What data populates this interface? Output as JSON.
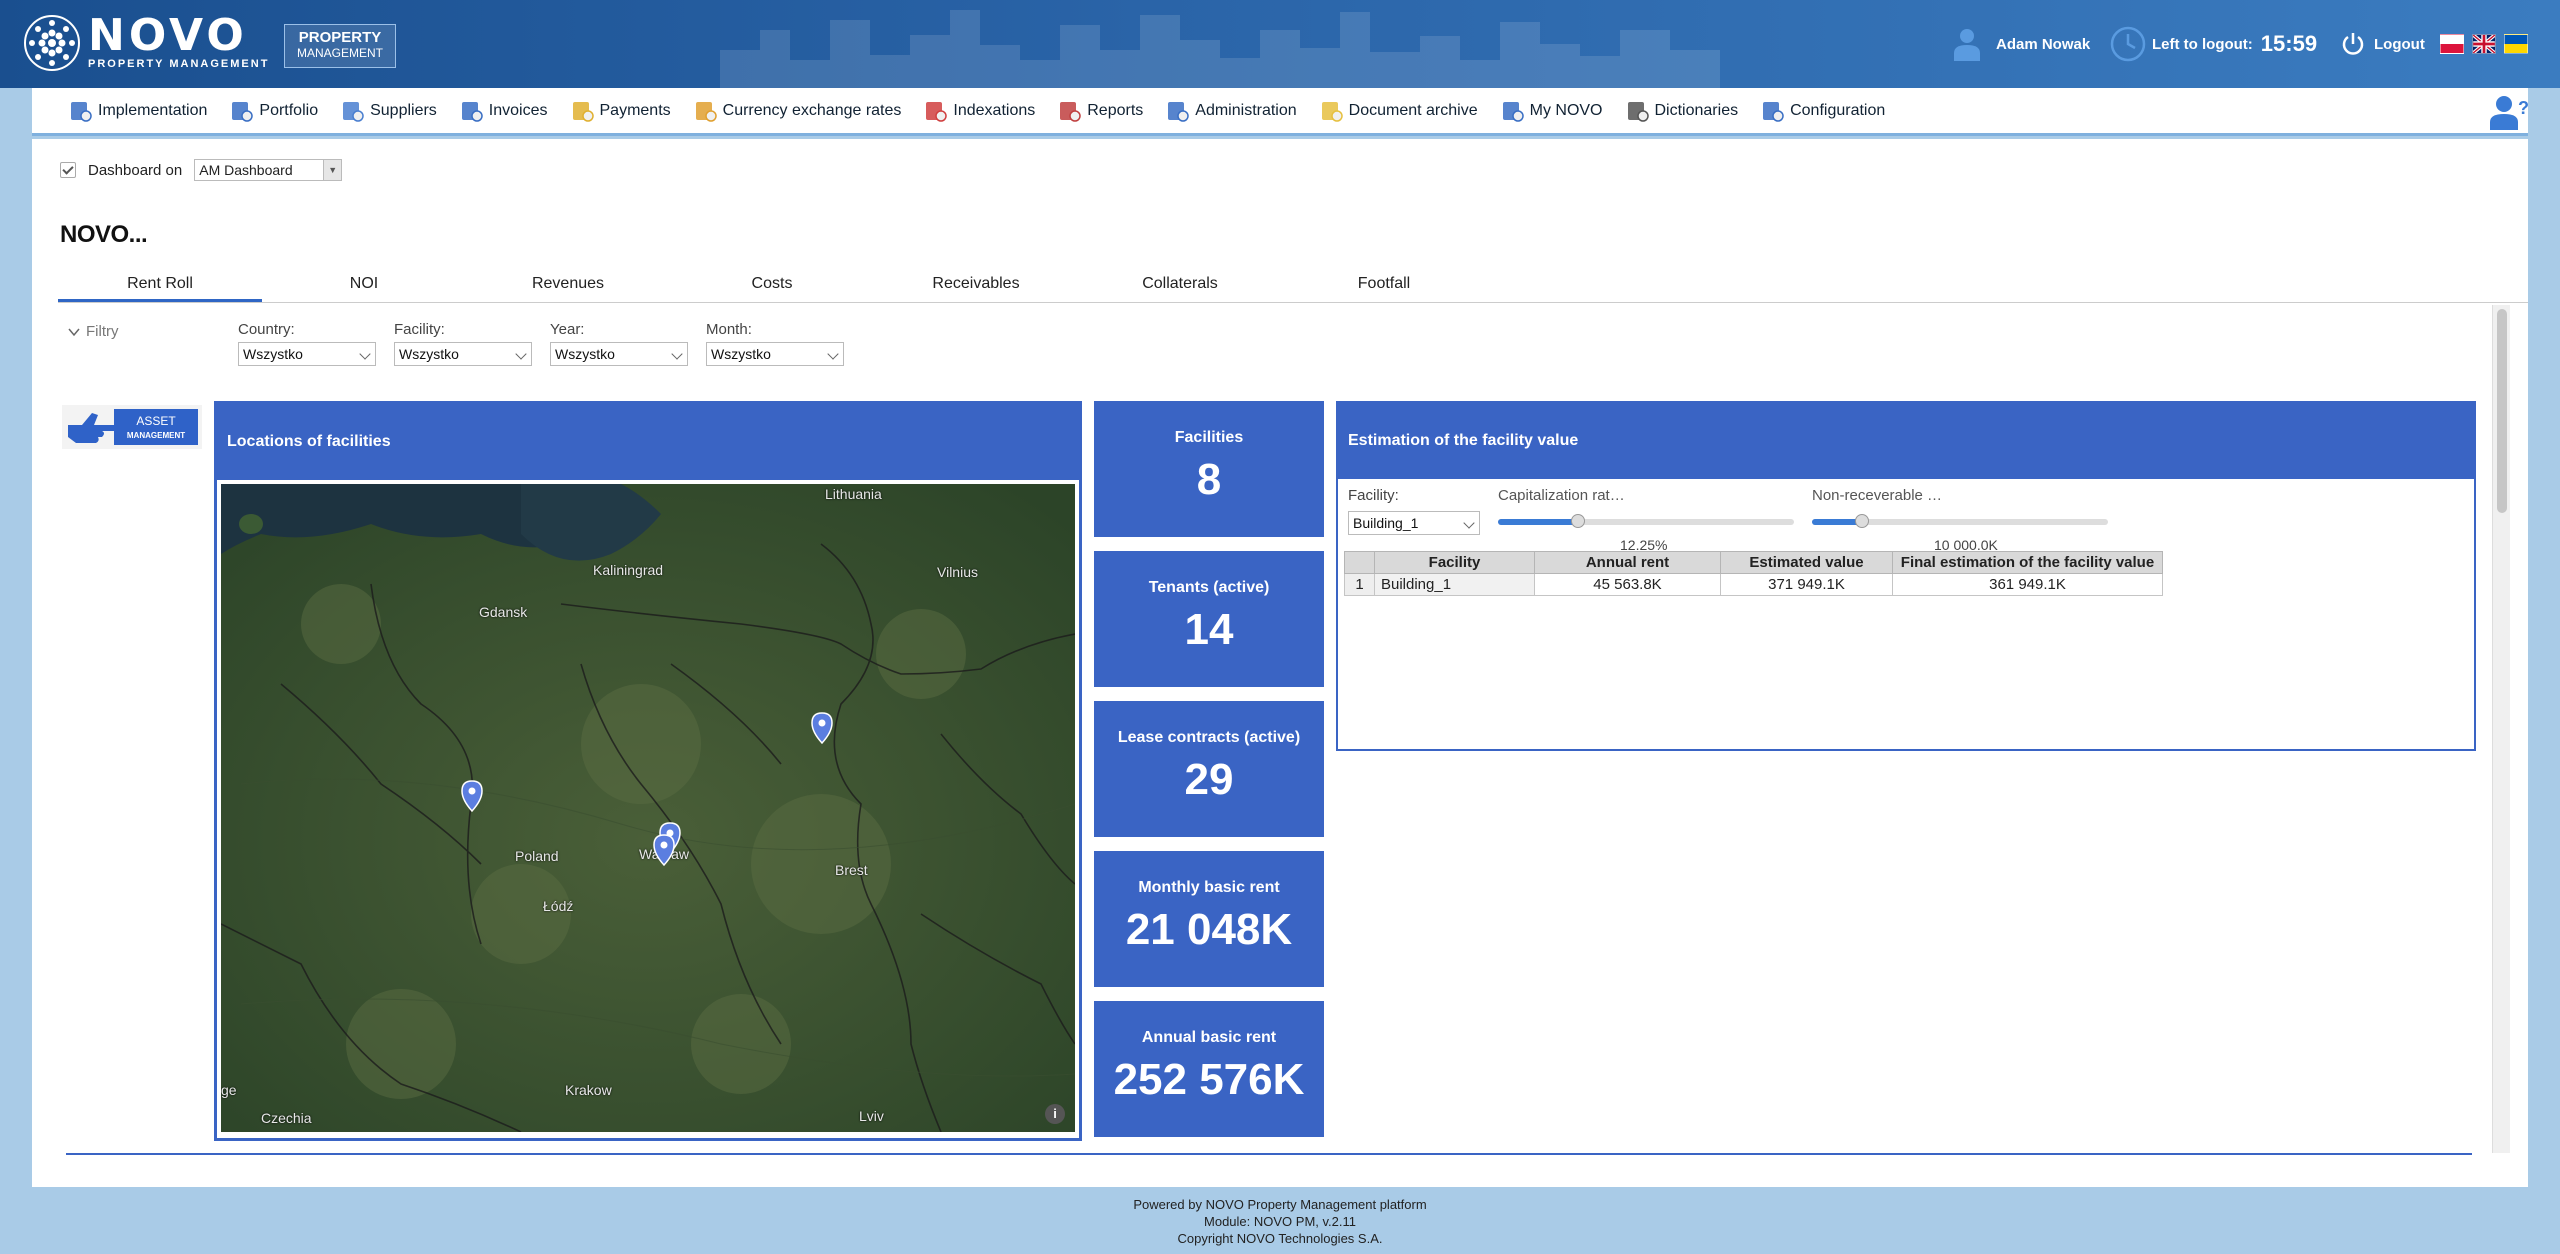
{
  "header": {
    "logo_text": "NOVO",
    "logo_sub": "PROPERTY MANAGEMENT",
    "product_box": [
      "PROPERTY",
      "MANAGEMENT"
    ],
    "user_name": "Adam Nowak",
    "logout_label_prefix": "Left to logout:",
    "logout_timer": "15:59",
    "logout_button": "Logout",
    "flags": [
      "pl-flag",
      "uk-flag",
      "ua-flag"
    ]
  },
  "nav": {
    "items": [
      {
        "label": "Implementation",
        "icon": "document-gear-icon"
      },
      {
        "label": "Portfolio",
        "icon": "buildings-icon"
      },
      {
        "label": "Suppliers",
        "icon": "supplier-cart-icon"
      },
      {
        "label": "Invoices",
        "icon": "invoice-icon"
      },
      {
        "label": "Payments",
        "icon": "money-icon"
      },
      {
        "label": "Currency exchange rates",
        "icon": "currency-icon"
      },
      {
        "label": "Indexations",
        "icon": "chart-up-icon"
      },
      {
        "label": "Reports",
        "icon": "pie-chart-icon"
      },
      {
        "label": "Administration",
        "icon": "admin-user-icon"
      },
      {
        "label": "Document archive",
        "icon": "folder-icon"
      },
      {
        "label": "My NOVO",
        "icon": "gears-icon"
      },
      {
        "label": "Dictionaries",
        "icon": "books-icon"
      },
      {
        "label": "Configuration",
        "icon": "config-gears-icon"
      }
    ]
  },
  "dashboard": {
    "dashboard_on_label": "Dashboard on",
    "dashboard_select": "AM Dashboard",
    "title": "NOVO...",
    "tabs": [
      "Rent Roll",
      "NOI",
      "Revenues",
      "Costs",
      "Receivables",
      "Collaterals",
      "Footfall"
    ],
    "active_tab": "Rent Roll"
  },
  "filters": {
    "toggle_label": "Filtry",
    "country": {
      "label": "Country:",
      "value": "Wszystko"
    },
    "facility": {
      "label": "Facility:",
      "value": "Wszystko"
    },
    "year": {
      "label": "Year:",
      "value": "Wszystko"
    },
    "month": {
      "label": "Month:",
      "value": "Wszystko"
    }
  },
  "asset_badge": [
    "ASSET",
    "MANAGEMENT"
  ],
  "map": {
    "title": "Locations of facilities",
    "labels": [
      "Lithuania",
      "Kaliningrad",
      "Vilnius",
      "Gdansk",
      "Poland",
      "Warsaw",
      "Brest",
      "Łódź",
      "Krakow",
      "Lviv",
      "Czechia",
      "ge"
    ],
    "info_glyph": "i"
  },
  "kpis": [
    {
      "label": "Facilities",
      "value": "8"
    },
    {
      "label": "Tenants (active)",
      "value": "14"
    },
    {
      "label": "Lease contracts (active)",
      "value": "29"
    },
    {
      "label": "Monthly basic rent",
      "value": "21 048K"
    },
    {
      "label": "Annual basic rent",
      "value": "252 576K"
    }
  ],
  "estimation": {
    "title": "Estimation of the facility value",
    "facility_label": "Facility:",
    "facility_value": "Building_1",
    "cap_rate_label": "Capitalization rat…",
    "cap_rate_value": "12.25%",
    "cap_rate_fraction": 0.27,
    "nonrec_label": "Non-receverable …",
    "nonrec_value": "10 000.0K",
    "nonrec_fraction": 0.17,
    "columns": [
      "Facility",
      "Annual rent",
      "Estimated value",
      "Final estimation of the facility value"
    ],
    "rows": [
      {
        "n": "1",
        "facility": "Building_1",
        "annual_rent": "45 563.8K",
        "estimated": "371 949.1K",
        "final": "361 949.1K"
      }
    ]
  },
  "footer": {
    "line1": "Powered by NOVO Property Management platform",
    "line2": "Module: NOVO PM, v.2.11",
    "line3": "Copyright NOVO Technologies S.A."
  },
  "colors": {
    "header_dark": "#1a4f8f",
    "accent": "#3a64c4",
    "page_bg": "#a9cbe7"
  }
}
